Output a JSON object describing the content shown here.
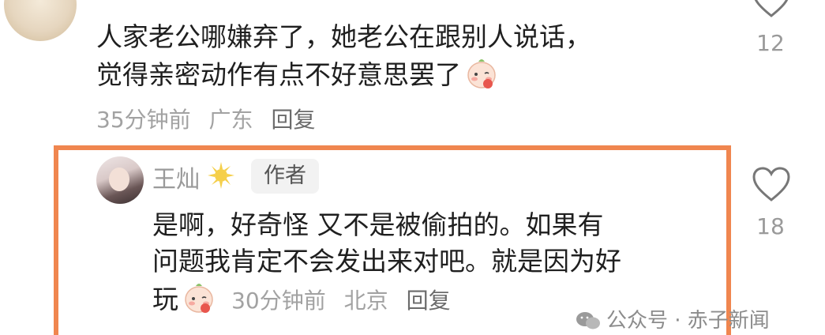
{
  "top_comment": {
    "line1": "人家老公哪嫌弃了，她老公在跟别人说话，",
    "line2": "觉得亲密动作有点不好意思罢了",
    "time": "35分钟前",
    "location": "广东",
    "reply": "回复",
    "likes": "12",
    "emoji": "blushing-peach-emoji"
  },
  "reply_comment": {
    "author": "王灿",
    "badge": "作者",
    "line1": "是啊，好奇怪 又不是被偷拍的。如果有",
    "line2": "问题我肯定不会发出来对吧。就是因为好",
    "line3": "玩",
    "time": "30分钟前",
    "location": "北京",
    "reply": "回复",
    "likes": "18",
    "emoji": "blushing-peach-emoji",
    "highlight_color": "#f0864f"
  },
  "watermark": {
    "text": "公众号 · 赤子新闻"
  }
}
